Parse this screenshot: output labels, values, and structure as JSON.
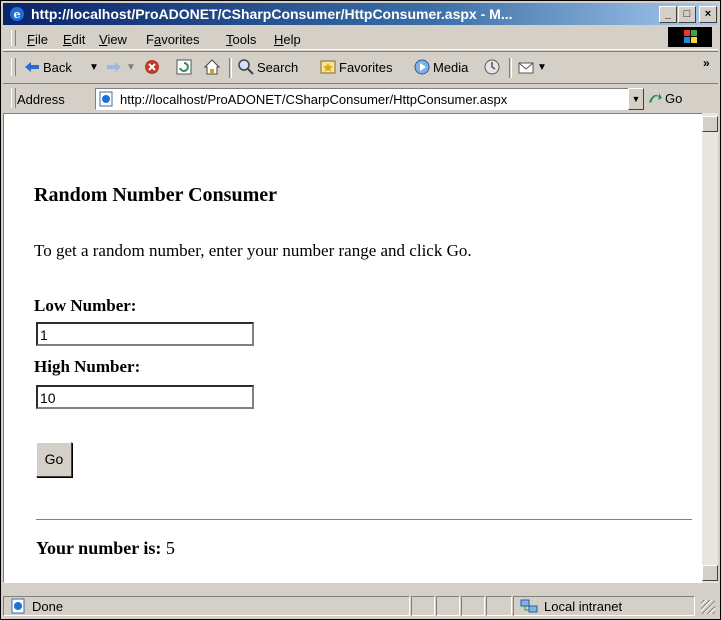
{
  "window": {
    "title": "http://localhost/ProADONET/CSharpConsumer/HttpConsumer.aspx - M..."
  },
  "menu": [
    {
      "label": "File",
      "accel": "F",
      "rest": "ile"
    },
    {
      "label": "Edit",
      "accel": "E",
      "rest": "dit"
    },
    {
      "label": "View",
      "accel": "V",
      "rest": "iew"
    },
    {
      "label": "Favorites",
      "accel": "a",
      "pre": "F",
      "rest": "vorites"
    },
    {
      "label": "Tools",
      "accel": "T",
      "rest": "ools"
    },
    {
      "label": "Help",
      "accel": "H",
      "rest": "elp"
    }
  ],
  "toolbar": {
    "back_label": "Back",
    "search_label": "Search",
    "favorites_label": "Favorites",
    "media_label": "Media",
    "overflow": "»"
  },
  "address": {
    "label": "Address",
    "url": "http://localhost/ProADONET/CSharpConsumer/HttpConsumer.aspx",
    "go_label": "Go"
  },
  "page": {
    "title": "Random Number Consumer",
    "intro": "To get a random number, enter your number range and click Go.",
    "low_label": "Low Number:",
    "low_value": "1",
    "high_label": "High Number:",
    "high_value": "10",
    "go_button": "Go",
    "result_label": "Your number is:",
    "result_value": "5"
  },
  "status": {
    "text": "Done",
    "zone": "Local intranet"
  },
  "colors": {
    "titlebar_start": "#0a246a",
    "titlebar_end": "#a6caf0",
    "chrome": "#d4d0c8"
  }
}
